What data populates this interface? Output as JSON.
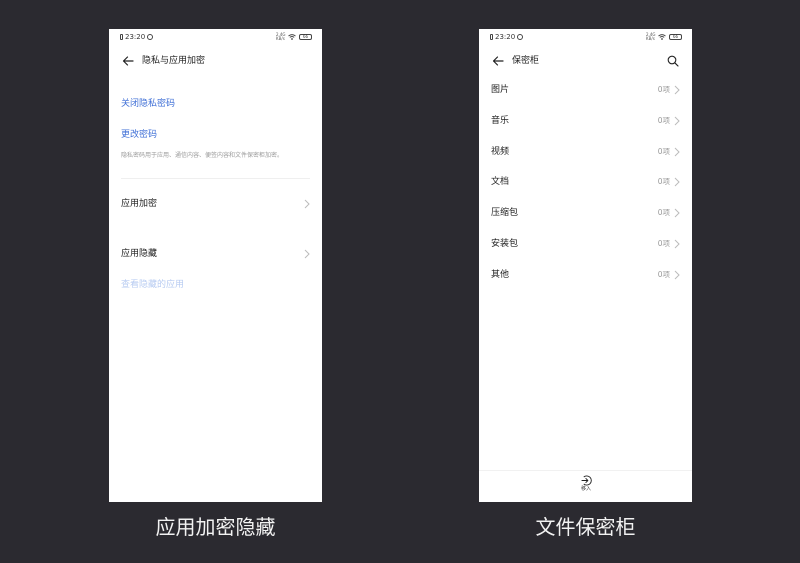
{
  "colors": {
    "background": "#2b2a30",
    "link": "#3f6fd6",
    "link_faded": "#b8ccf2",
    "muted": "#999999"
  },
  "left_phone": {
    "status_bar": {
      "time": "23:20",
      "network": "2.4G\nKB/s",
      "battery": "66"
    },
    "title": "隐私与应用加密",
    "close_password_link": "关闭隐私密码",
    "change_password_link": "更改密码",
    "description": "隐私密码用于应用、通信内容、便签内容和文件保密柜加密。",
    "app_encryption_label": "应用加密",
    "app_hide_label": "应用隐藏",
    "view_hidden_apps_link": "查看隐藏的应用"
  },
  "right_phone": {
    "status_bar": {
      "time": "23:20",
      "network": "2.4G\nKB/s",
      "battery": "66"
    },
    "title": "保密柜",
    "items": [
      {
        "label": "图片",
        "count": "0项"
      },
      {
        "label": "音乐",
        "count": "0项"
      },
      {
        "label": "视频",
        "count": "0项"
      },
      {
        "label": "文档",
        "count": "0项"
      },
      {
        "label": "压缩包",
        "count": "0项"
      },
      {
        "label": "安装包",
        "count": "0项"
      },
      {
        "label": "其他",
        "count": "0项"
      }
    ],
    "import_label": "移入"
  },
  "captions": {
    "left": "应用加密隐藏",
    "right": "文件保密柜"
  }
}
